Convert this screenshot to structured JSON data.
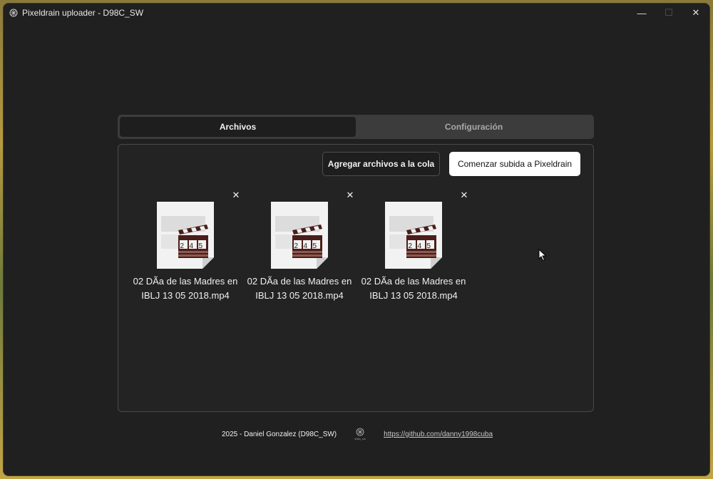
{
  "window": {
    "title": "Pixeldrain uploader - D98C_SW",
    "minimize_glyph": "—",
    "maximize_glyph": "☐",
    "close_glyph": "✕"
  },
  "tabs": [
    {
      "label": "Archivos",
      "active": true
    },
    {
      "label": "Configuración",
      "active": false
    }
  ],
  "actions": {
    "queue_label": "Agregar archivos a la cola",
    "start_label": "Comenzar subida a Pixeldrain"
  },
  "files": [
    {
      "name_line1": "02 DÃa de las Madres en",
      "name_line2": "IBLJ 13 05 2018.mp4",
      "icon": "video-file-icon",
      "remove": "✕"
    },
    {
      "name_line1": "02 DÃa de las Madres en",
      "name_line2": "IBLJ 13 05 2018.mp4",
      "icon": "video-file-icon",
      "remove": "✕"
    },
    {
      "name_line1": "02 DÃa de las Madres en",
      "name_line2": "IBLJ 13 05 2018.mp4",
      "icon": "video-file-icon",
      "remove": "✕"
    }
  ],
  "clapper_digits": [
    "2",
    "4",
    "5"
  ],
  "footer": {
    "credit": "2025 - Daniel Gonzalez (D98C_SW)",
    "logo_caption": "d98c_sw",
    "link": "https://github.com/danny1998cuba"
  },
  "colors": {
    "window_bg": "#202020",
    "accent_button": "#ffffff",
    "tab_bar": "#3c3c3c"
  }
}
